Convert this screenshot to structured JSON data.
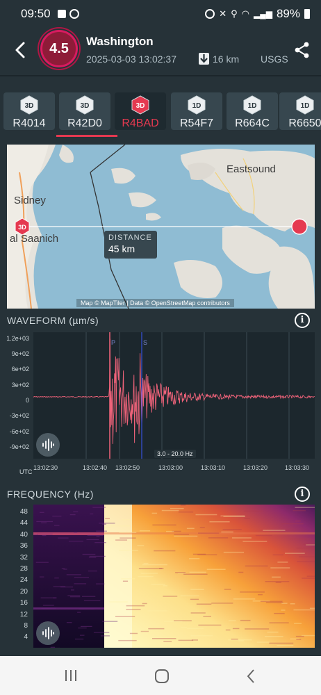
{
  "status": {
    "time": "09:50",
    "battery": "89%"
  },
  "header": {
    "magnitude": "4.5",
    "place": "Washington",
    "datetime": "2025-03-03 13:02:37",
    "depth": "16 km",
    "source": "USGS"
  },
  "stations": [
    {
      "badge": "3D",
      "label": "R4014",
      "active": false
    },
    {
      "badge": "3D",
      "label": "R42D0",
      "active": false
    },
    {
      "badge": "3D",
      "label": "R4BAD",
      "active": true
    },
    {
      "badge": "1D",
      "label": "R54F7",
      "active": false
    },
    {
      "badge": "1D",
      "label": "R664C",
      "active": false
    },
    {
      "badge": "1D",
      "label": "R6650",
      "active": false
    }
  ],
  "map": {
    "labels": {
      "eastsound": "Eastsound",
      "sidney": "Sidney",
      "saanich": "al Saanich"
    },
    "station_marker": "3D",
    "distance_label": "DISTANCE",
    "distance_value": "45 km",
    "attribution": "Map © MapTiler | Data © OpenStreetMap contributors"
  },
  "waveform": {
    "title": "WAVEFORM (µm/s)",
    "y_ticks": [
      "1.2e+03",
      "9e+02",
      "6e+02",
      "3e+02",
      "0",
      "-3e+02",
      "-6e+02",
      "-9e+02"
    ],
    "x_ticks": [
      "UTC",
      "13:02:30",
      "13:02:40",
      "13:02:50",
      "13:03:00",
      "13:03:10",
      "13:03:20",
      "13:03:30"
    ],
    "p_label": "P",
    "s_label": "S",
    "filter": "3.0 - 20.0 Hz",
    "line_color": "#f0637a"
  },
  "frequency": {
    "title": "FREQUENCY (Hz)",
    "y_ticks": [
      "48",
      "44",
      "40",
      "36",
      "32",
      "28",
      "24",
      "20",
      "16",
      "12",
      "8",
      "4"
    ]
  },
  "colors": {
    "accent": "#e53950",
    "background": "#263238",
    "magnitude_fill": "#8e1b38"
  },
  "icons": [
    "back-icon",
    "share-icon",
    "info-icon",
    "sound-wave-icon",
    "depth-arrow-icon"
  ]
}
